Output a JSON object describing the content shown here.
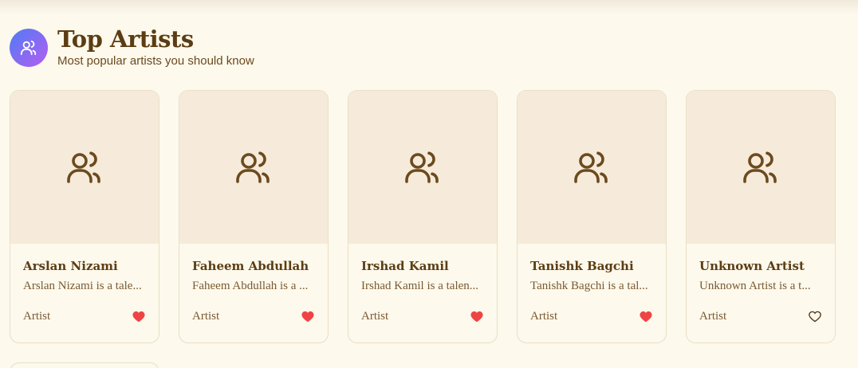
{
  "header": {
    "title": "Top Artists",
    "subtitle": "Most popular artists you should know",
    "icon": "users-icon",
    "icon_gradient": [
      "#4f7cf5",
      "#b45ef0"
    ]
  },
  "artists": [
    {
      "name": "Arslan Nizami",
      "description": "Arslan Nizami is a tale...",
      "role": "Artist",
      "liked": true
    },
    {
      "name": "Faheem Abdullah",
      "description": "Faheem Abdullah is a ...",
      "role": "Artist",
      "liked": true
    },
    {
      "name": "Irshad Kamil",
      "description": "Irshad Kamil is a talen...",
      "role": "Artist",
      "liked": true
    },
    {
      "name": "Tanishk Bagchi",
      "description": "Tanishk Bagchi is a tal...",
      "role": "Artist",
      "liked": true
    },
    {
      "name": "Unknown Artist",
      "description": "Unknown Artist is a t...",
      "role": "Artist",
      "liked": false
    }
  ],
  "colors": {
    "background": "#fdf9ec",
    "card_image_bg": "#f6ebda",
    "text_brown": "#5c3d13",
    "heart_liked": "#ef4444"
  }
}
